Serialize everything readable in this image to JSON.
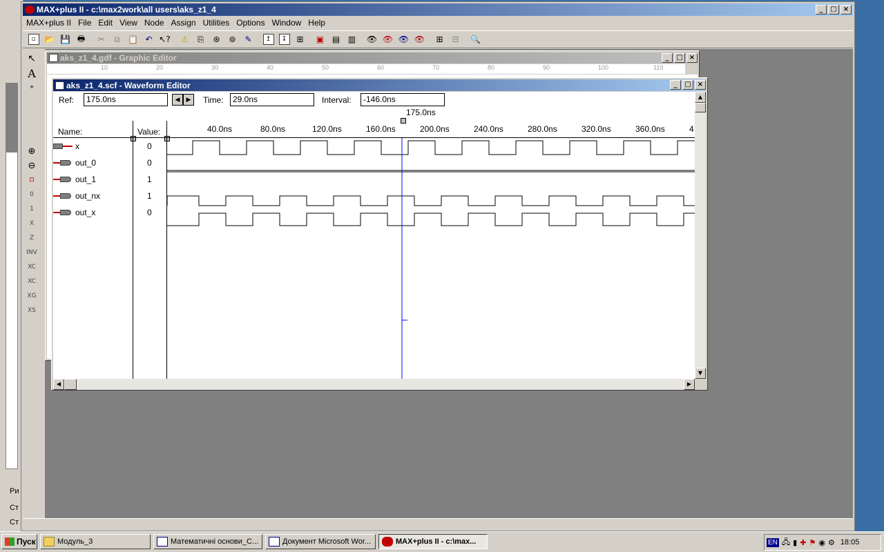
{
  "app": {
    "title": "MAX+plus II - c:\\max2work\\all users\\aks_z1_4",
    "menu": [
      {
        "label": "MAX+plus II"
      },
      {
        "label": "File"
      },
      {
        "label": "Edit"
      },
      {
        "label": "View"
      },
      {
        "label": "Node"
      },
      {
        "label": "Assign"
      },
      {
        "label": "Utilities"
      },
      {
        "label": "Options"
      },
      {
        "label": "Window"
      },
      {
        "label": "Help"
      }
    ]
  },
  "graphic_editor": {
    "title": "aks_z1_4.gdf - Graphic Editor",
    "ruler_ticks": [
      "10",
      "20",
      "30",
      "40",
      "50",
      "60",
      "70",
      "80",
      "90",
      "100",
      "110"
    ]
  },
  "waveform_editor": {
    "title": "aks_z1_4.scf - Waveform Editor",
    "ref_label": "Ref:",
    "ref_value": "175.0ns",
    "time_label": "Time:",
    "time_value": "29.0ns",
    "interval_label": "Interval:",
    "interval_value": "-146.0ns",
    "cursor_label": "175.0ns",
    "name_header": "Name:",
    "value_header": "Value:",
    "time_ticks": [
      "40.0ns",
      "80.0ns",
      "120.0ns",
      "160.0ns",
      "200.0ns",
      "240.0ns",
      "280.0ns",
      "320.0ns",
      "360.0ns",
      "4"
    ],
    "signals": [
      {
        "name": "x",
        "value": "0",
        "kind": "input"
      },
      {
        "name": "out_0",
        "value": "0",
        "kind": "output"
      },
      {
        "name": "out_1",
        "value": "1",
        "kind": "output"
      },
      {
        "name": "out_nx",
        "value": "1",
        "kind": "output"
      },
      {
        "name": "out_x",
        "value": "0",
        "kind": "output"
      }
    ]
  },
  "left_panel": {
    "row1": "Ри",
    "row2": "Ст",
    "row3": "Ст"
  },
  "taskbar": {
    "start": "Пуск",
    "items": [
      {
        "label": "Модуль_3"
      },
      {
        "label": "Математичні основи_С..."
      },
      {
        "label": "Документ Microsoft Wor..."
      },
      {
        "label": "MAX+plus II - c:\\max..."
      }
    ],
    "lang": "EN",
    "clock": "18:05"
  },
  "colors": {
    "titlebar": "#0a246a",
    "workspace": "#808080",
    "signal_marker": "#c00000",
    "cursor": "#0000ff"
  }
}
